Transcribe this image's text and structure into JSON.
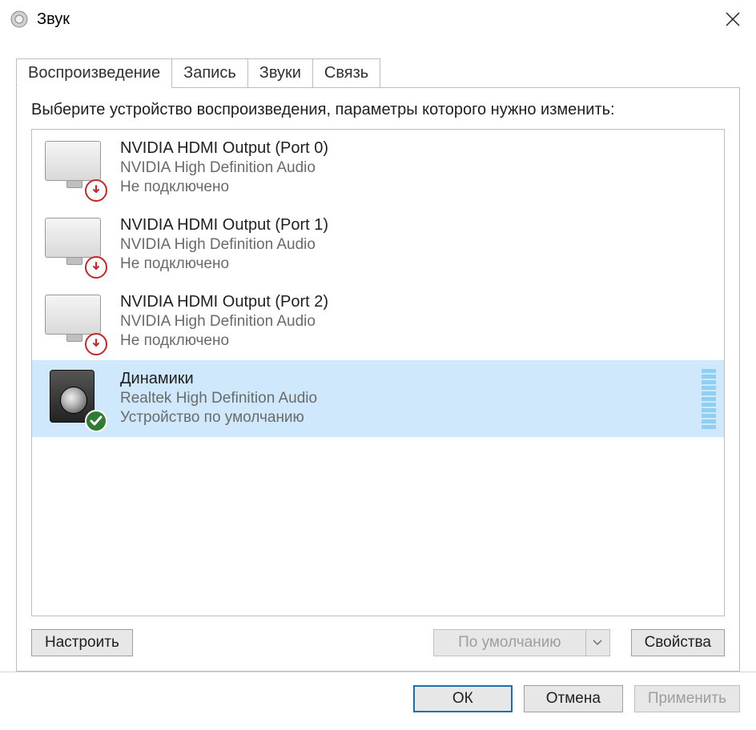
{
  "window": {
    "title": "Звук"
  },
  "tabs": [
    {
      "label": "Воспроизведение",
      "active": true
    },
    {
      "label": "Запись",
      "active": false
    },
    {
      "label": "Звуки",
      "active": false
    },
    {
      "label": "Связь",
      "active": false
    }
  ],
  "instruction": "Выберите устройство воспроизведения, параметры которого нужно изменить:",
  "devices": [
    {
      "name": "NVIDIA HDMI Output (Port 0)",
      "desc": "NVIDIA High Definition Audio",
      "status": "Не подключено",
      "icon": "monitor",
      "badge": "error",
      "selected": false
    },
    {
      "name": "NVIDIA HDMI Output (Port 1)",
      "desc": "NVIDIA High Definition Audio",
      "status": "Не подключено",
      "icon": "monitor",
      "badge": "error",
      "selected": false
    },
    {
      "name": "NVIDIA HDMI Output (Port 2)",
      "desc": "NVIDIA High Definition Audio",
      "status": "Не подключено",
      "icon": "monitor",
      "badge": "error",
      "selected": false
    },
    {
      "name": "Динамики",
      "desc": "Realtek High Definition Audio",
      "status": "Устройство по умолчанию",
      "icon": "speaker",
      "badge": "ok",
      "selected": true
    }
  ],
  "panel_buttons": {
    "configure": "Настроить",
    "default_dropdown": "По умолчанию",
    "properties": "Свойства"
  },
  "footer_buttons": {
    "ok": "ОК",
    "cancel": "Отмена",
    "apply": "Применить"
  }
}
